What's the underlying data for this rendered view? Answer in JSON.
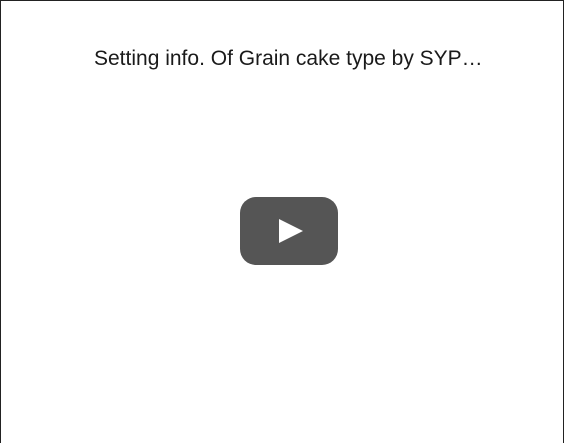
{
  "video": {
    "title": "Setting info. Of Grain cake type by SYP…"
  },
  "icons": {
    "play": "play-icon"
  },
  "colors": {
    "play_button_bg": "#555555",
    "play_glyph": "#ffffff",
    "border": "#222222",
    "title_text": "#1a1a1a"
  }
}
